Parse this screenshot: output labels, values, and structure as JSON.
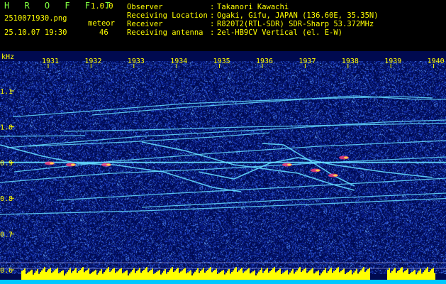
{
  "app": {
    "name": "H R O F F T",
    "version": "1.0.0"
  },
  "file": {
    "name": "2510071930.png",
    "datetime": "25.10.07 19:30"
  },
  "meteor": {
    "label": "meteor",
    "count": "46"
  },
  "station": [
    {
      "label": "Observer",
      "value": "Takanori Kawachi"
    },
    {
      "label": "Receiving Location",
      "value": "Ogaki, Gifu, JAPAN (136.60E, 35.35N)"
    },
    {
      "label": "Receiver",
      "value": "R820T2(RTL-SDR) SDR-Sharp 53.372MHz"
    },
    {
      "label": "Receiving antenna",
      "value": "2el-HB9CV Vertical (el. E-W)"
    }
  ],
  "separator": ":",
  "spectrogram": {
    "unit_label": "kHz",
    "time_ticks": [
      "1931",
      "1932",
      "1933",
      "1934",
      "1935",
      "1936",
      "1937",
      "1938",
      "1939",
      "1940"
    ],
    "freq_ticks": [
      "1.1",
      "1.0",
      "0.9",
      "0.8",
      "0.7",
      "0.6"
    ],
    "colors": {
      "background": "#000a50",
      "noise_low": "#0a1e8c",
      "noise_high": "#3c64dc",
      "trace": "#64dcff",
      "trace_hot": "#ff4080",
      "trace_warm": "#ffe040",
      "axis_text": "#ffff00",
      "level_bar": "#ffff00",
      "bottom_strip": "#00c8ff",
      "ref_line": "#c8c8ff"
    }
  }
}
